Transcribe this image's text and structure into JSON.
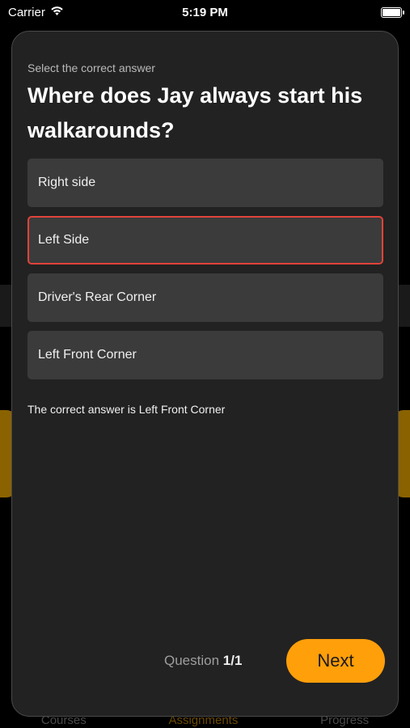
{
  "status_bar": {
    "carrier": "Carrier",
    "time": "5:19 PM",
    "wifi_icon": "wifi-icon",
    "battery_icon": "battery-icon"
  },
  "background_tabs": [
    {
      "label": "Courses"
    },
    {
      "label": "Assignments"
    },
    {
      "label": "Progress"
    }
  ],
  "quiz": {
    "prompt": "Select the correct answer",
    "question": "Where does Jay always start his walkarounds?",
    "options": [
      {
        "label": "Right side",
        "selected": false
      },
      {
        "label": "Left Side",
        "selected": true
      },
      {
        "label": "Driver's Rear Corner",
        "selected": false
      },
      {
        "label": "Left Front Corner",
        "selected": false
      }
    ],
    "feedback": "The correct answer is Left Front Corner",
    "counter_label": "Question",
    "counter_value": "1/1",
    "next_label": "Next"
  },
  "colors": {
    "accent": "#ff9f0a",
    "selected_border": "#e0433a",
    "modal_bg": "#222222",
    "option_bg": "#3b3b3b"
  }
}
